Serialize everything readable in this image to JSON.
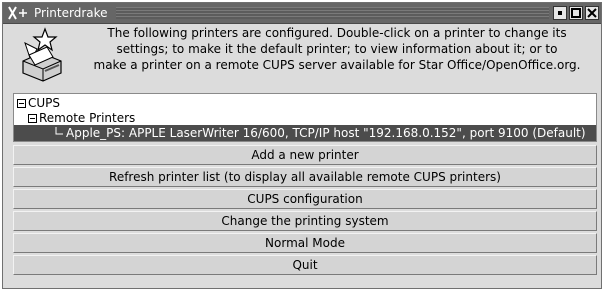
{
  "titlebar": {
    "logo": "X",
    "title": "Printerdrake",
    "buttons": [
      "minimize-icon",
      "maximize-icon",
      "close-icon"
    ]
  },
  "header": {
    "icon": "printer-star-icon",
    "lines": [
      "The following printers are configured. Double-click on a printer to change its",
      "settings; to make it the default printer; to view information about it; or to",
      "make a printer on a remote CUPS server available for Star Office/OpenOffice.org."
    ]
  },
  "tree": {
    "root": "CUPS",
    "group": "Remote Printers",
    "printer": "Apple_PS: APPLE LaserWriter 16/600, TCP/IP host \"192.168.0.152\", port 9100 (Default)"
  },
  "buttons": {
    "add": "Add a new printer",
    "refresh": "Refresh printer list (to display all available remote CUPS printers)",
    "cups_config": "CUPS configuration",
    "change_system": "Change the printing system",
    "normal_mode": "Normal Mode",
    "quit": "Quit"
  },
  "colors": {
    "titlebar": "#666666",
    "selection": "#4c4c4c",
    "window_bg": "#dcdcdc"
  }
}
